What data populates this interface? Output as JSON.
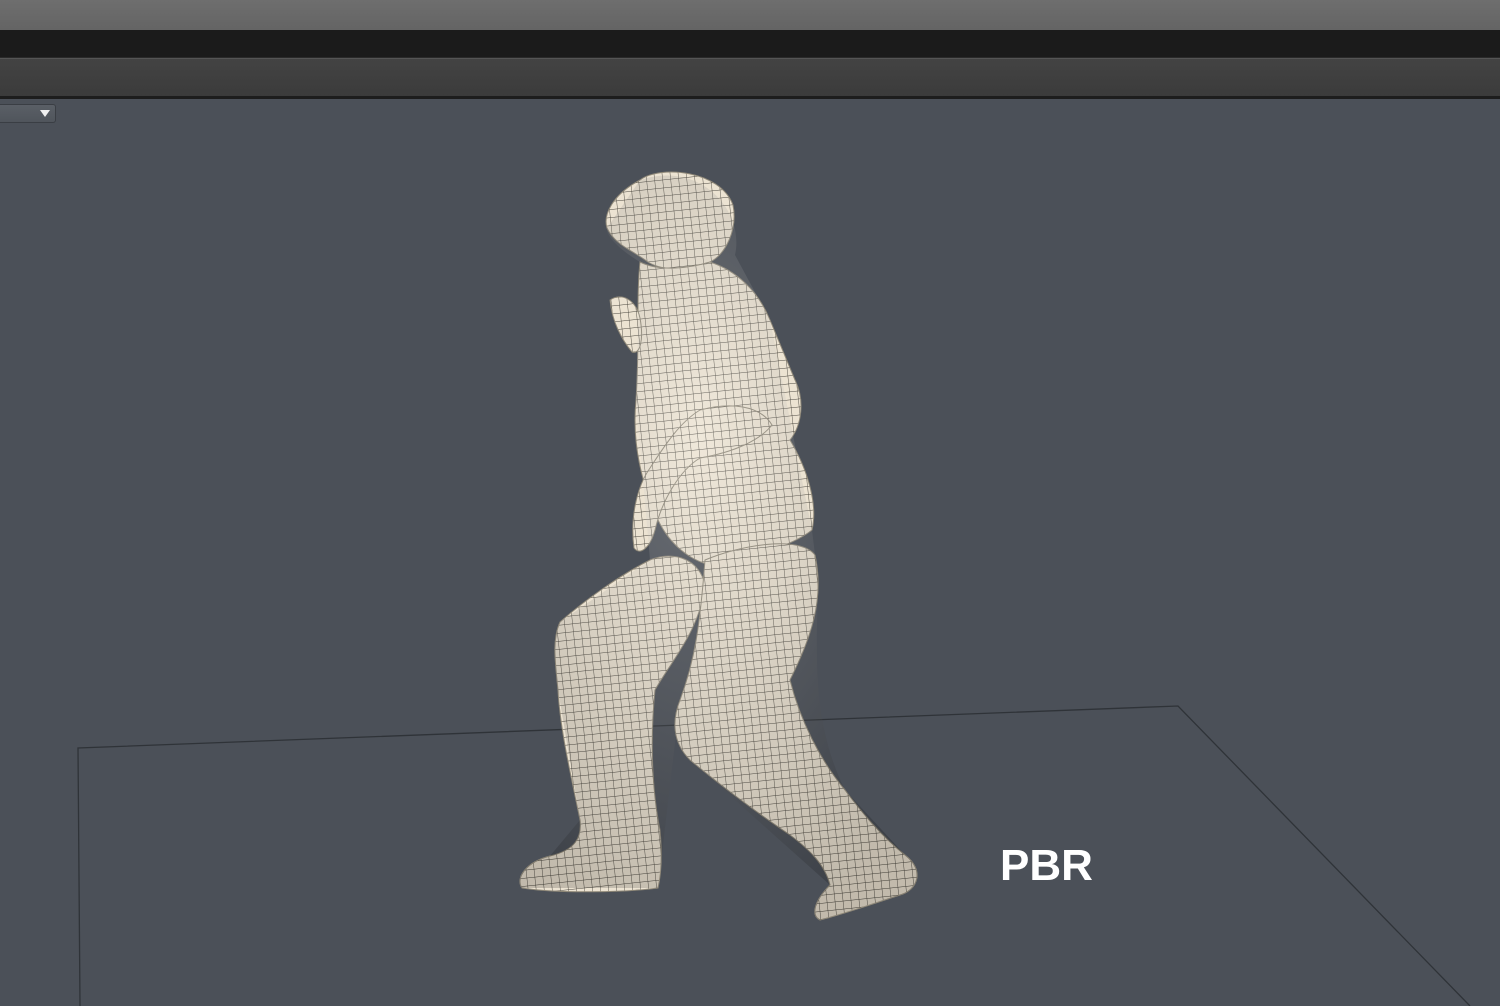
{
  "viewport": {
    "shading_dropdown": {
      "value": "",
      "icon": "chevron-down-icon"
    },
    "render_mode_label": "PBR"
  },
  "colors": {
    "background": "#4b5058",
    "model_base": "#ece3d2",
    "wireframe": "#4a463e",
    "ground_outline": "#2f3338"
  }
}
